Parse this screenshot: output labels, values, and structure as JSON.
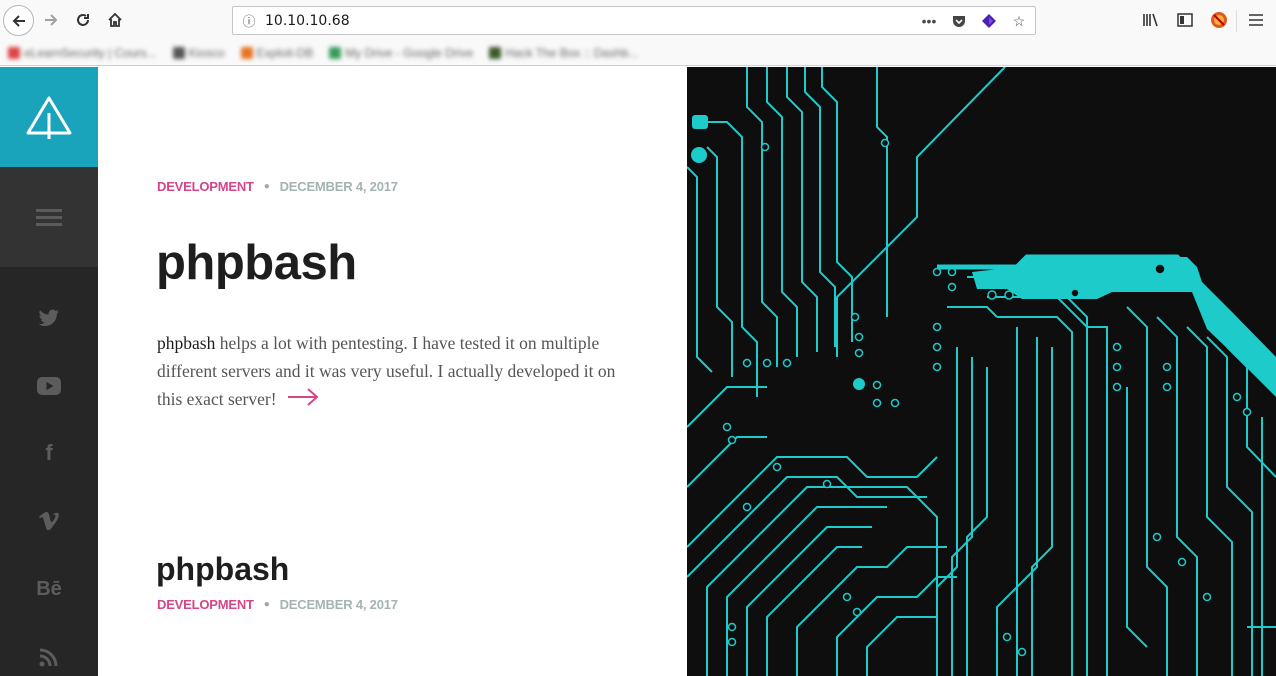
{
  "browser": {
    "url": "10.10.10.68",
    "bookmarks": [
      "eLearnSecurity | Cours...",
      "Kiosco",
      "Exploit-DB",
      "My Drive - Google Drive",
      "Hack The Box :: Dashb..."
    ]
  },
  "sidebar": {
    "social": [
      "twitter-icon",
      "youtube-icon",
      "facebook-icon",
      "vimeo-icon",
      "behance-icon",
      "rss-icon"
    ],
    "behance_label": "Bē",
    "facebook_label": "f"
  },
  "post": {
    "category": "DEVELOPMENT",
    "date": "DECEMBER 4, 2017",
    "title": "phpbash",
    "excerpt_lead": "phpbash",
    "excerpt_rest": " helps a lot with pentesting. I have tested it on multiple different servers and it was very useful. I actually developed it on this exact server!"
  },
  "post2": {
    "title": "phpbash",
    "category": "DEVELOPMENT",
    "date": "DECEMBER 4, 2017"
  },
  "colors": {
    "accent": "#1aa4bc",
    "category": "#d4458a",
    "circuit": "#1ecbcb",
    "hero_bg": "#0e0e0e"
  }
}
